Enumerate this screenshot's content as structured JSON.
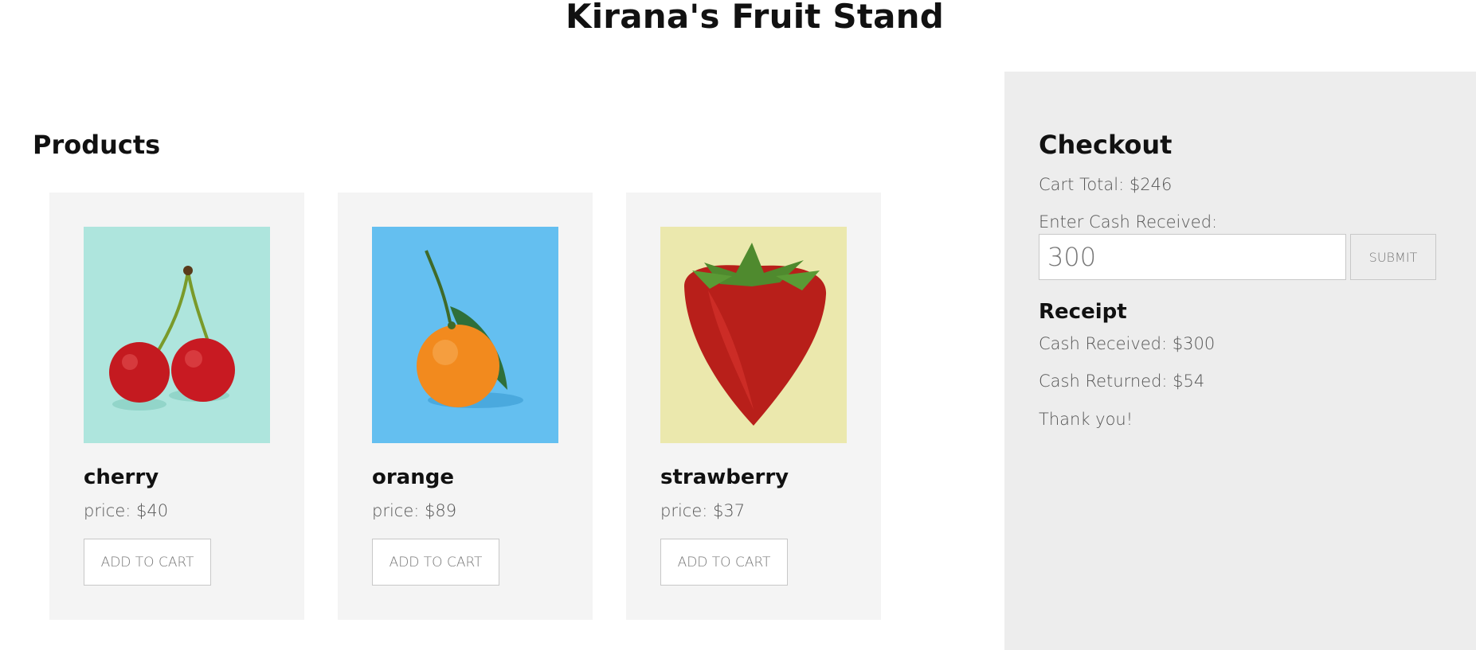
{
  "header": {
    "title": "Kirana's Fruit Stand"
  },
  "products": {
    "title": "Products",
    "items": [
      {
        "name": "cherry",
        "price_label": "price:",
        "price": "$40",
        "button": "ADD TO CART",
        "image_bg": "#aee5dd"
      },
      {
        "name": "orange",
        "price_label": "price:",
        "price": "$89",
        "button": "ADD TO CART",
        "image_bg": "#64bff0"
      },
      {
        "name": "strawberry",
        "price_label": "price:",
        "price": "$37",
        "button": "ADD TO CART",
        "image_bg": "#ebe8ad"
      }
    ]
  },
  "checkout": {
    "title": "Checkout",
    "cart_total_label": "Cart Total:",
    "cart_total": "$246",
    "cash_label": "Enter Cash Received:",
    "cash_value": "300",
    "submit": "SUBMIT",
    "receipt": {
      "title": "Receipt",
      "cash_received_label": "Cash Received:",
      "cash_received": "$300",
      "cash_returned_label": "Cash Returned:",
      "cash_returned": "$54",
      "thanks": "Thank you!"
    }
  },
  "colors": {
    "card_bg": "#f4f4f4",
    "checkout_bg": "#ededed",
    "text": "#111111",
    "muted": "#555555"
  }
}
